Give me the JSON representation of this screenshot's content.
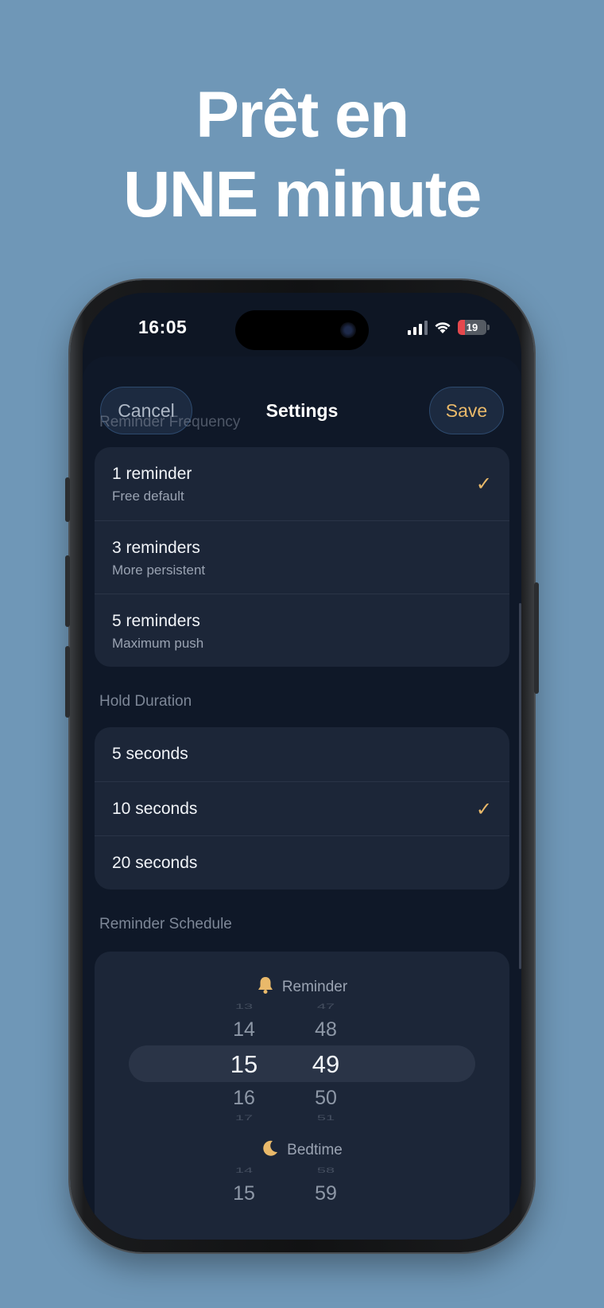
{
  "headline": {
    "line1": "Prêt en",
    "line2": "UNE minute"
  },
  "status_bar": {
    "time": "16:05",
    "battery": "19"
  },
  "nav": {
    "cancel": "Cancel",
    "title": "Settings",
    "save": "Save"
  },
  "frequency": {
    "label": "Reminder Frequency",
    "options": [
      {
        "title": "1 reminder",
        "subtitle": "Free default",
        "selected": true
      },
      {
        "title": "3 reminders",
        "subtitle": "More persistent",
        "selected": false
      },
      {
        "title": "5 reminders",
        "subtitle": "Maximum push",
        "selected": false
      }
    ]
  },
  "hold": {
    "label": "Hold Duration",
    "options": [
      {
        "title": "5 seconds",
        "selected": false
      },
      {
        "title": "10 seconds",
        "selected": true
      },
      {
        "title": "20 seconds",
        "selected": false
      }
    ]
  },
  "schedule": {
    "label": "Reminder Schedule",
    "reminder": {
      "label": "Reminder",
      "hours": [
        "13",
        "14",
        "15",
        "16",
        "17"
      ],
      "minutes": [
        "47",
        "48",
        "49",
        "50",
        "51"
      ],
      "selected_hour": "15",
      "selected_minute": "49"
    },
    "bedtime": {
      "label": "Bedtime",
      "hours": [
        "14",
        "15"
      ],
      "minutes": [
        "58",
        "59"
      ]
    }
  },
  "colors": {
    "background": "#6f97b7",
    "accent": "#e9b96a",
    "sheet": "#0f1828",
    "card": "#1c2638"
  }
}
